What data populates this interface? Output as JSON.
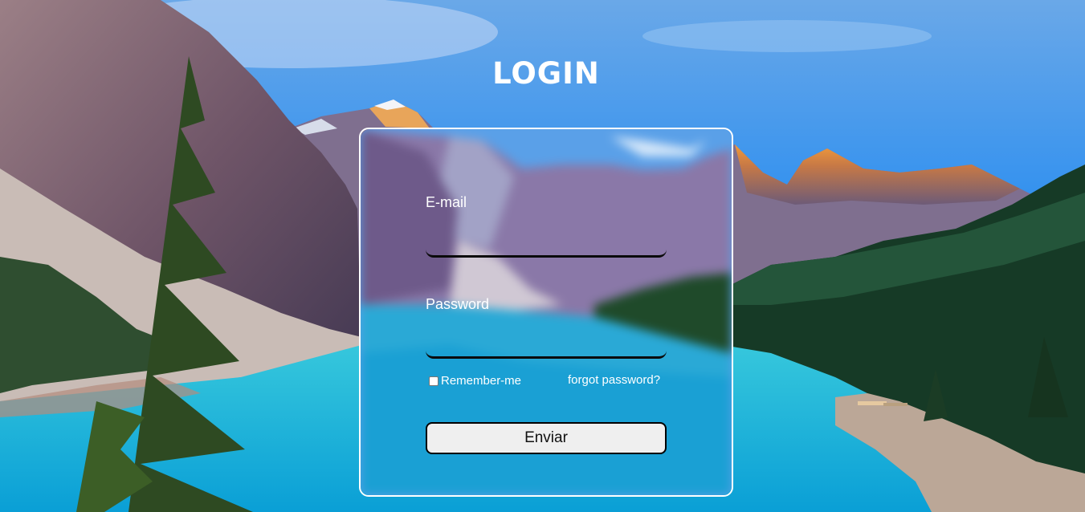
{
  "page": {
    "title": "LOGIN"
  },
  "form": {
    "email_label": "E-mail",
    "email_value": "",
    "password_label": "Password",
    "password_value": "",
    "remember_label": "Remember-me",
    "remember_checked": false,
    "forgot_label": "forgot password?",
    "submit_label": "Enviar"
  },
  "colors": {
    "text": "#ffffff",
    "card_border": "#ffffff",
    "input_underline": "#0a0a0a",
    "button_bg": "#efefef",
    "button_border": "#000000"
  }
}
